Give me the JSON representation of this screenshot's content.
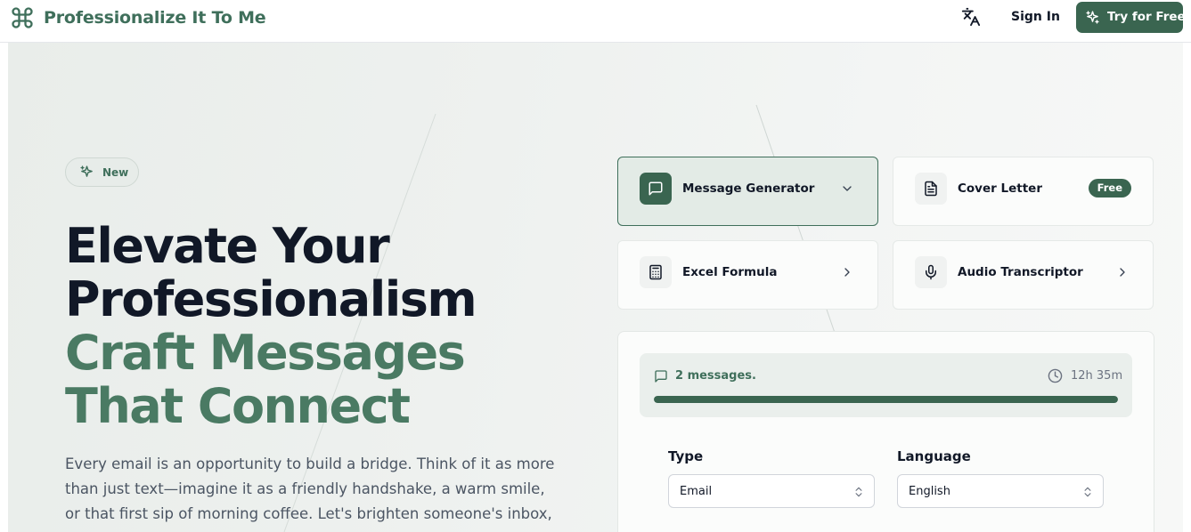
{
  "header": {
    "app_name": "Professionalize It To Me",
    "sign_in_label": "Sign In",
    "cta_label": "Try for Free",
    "icons": {
      "logo": "command-icon",
      "translate": "translate-icon",
      "cta": "sparkles-icon"
    }
  },
  "hero": {
    "badge_label": "New",
    "headline_line1": "Elevate Your",
    "headline_line2": "Professionalism",
    "headline_line3": "Craft Messages",
    "headline_line4": "That Connect",
    "description": "Every email is an opportunity to build a bridge. Think of it as more than just text—imagine it as a friendly handshake, a warm smile, or that first sip of morning coffee. Let's brighten someone's inbox, one"
  },
  "tools": [
    {
      "label": "Message Generator",
      "icon": "message-square-icon",
      "indicator": "chevron-down-icon",
      "active": true
    },
    {
      "label": "Cover Letter",
      "icon": "file-text-icon",
      "badge": "Free",
      "active": false
    },
    {
      "label": "Excel Formula",
      "icon": "calculator-icon",
      "indicator": "chevron-right-icon",
      "active": false
    },
    {
      "label": "Audio Transcriptor",
      "icon": "microphone-icon",
      "indicator": "chevron-right-icon",
      "active": false
    }
  ],
  "status": {
    "messages_label": "2 messages.",
    "time_left": "12h 35m",
    "progress_percent": 100
  },
  "form": {
    "type_label": "Type",
    "type_value": "Email",
    "language_label": "Language",
    "language_value": "English"
  },
  "colors": {
    "brand": "#3a6550",
    "brand_text": "#3f6f5b",
    "headline_dark": "#111827",
    "headline_green": "#4a7a63"
  }
}
